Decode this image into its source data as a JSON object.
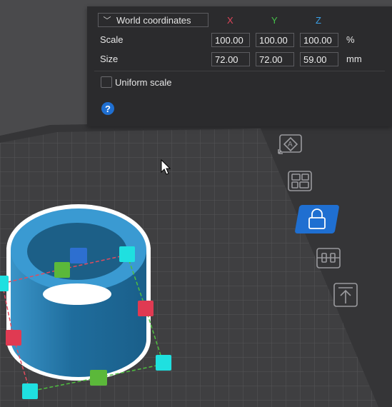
{
  "panel": {
    "coordinate_system": "World coordinates",
    "axes": {
      "x": "X",
      "y": "Y",
      "z": "Z"
    },
    "scale": {
      "label": "Scale",
      "x": "100.00",
      "y": "100.00",
      "z": "100.00",
      "unit": "%"
    },
    "size": {
      "label": "Size",
      "x": "72.00",
      "y": "72.00",
      "z": "59.00",
      "unit": "mm"
    },
    "uniform_scale": {
      "label": "Uniform scale",
      "checked": false
    },
    "help_icon": "question-circle-icon"
  },
  "toolbar": {
    "items": [
      {
        "name": "auto-orient-icon",
        "active": false
      },
      {
        "name": "arrange-icon",
        "active": false
      },
      {
        "name": "lock-icon",
        "active": true
      },
      {
        "name": "layer-editor-icon",
        "active": false
      },
      {
        "name": "lay-on-face-icon",
        "active": false
      }
    ]
  },
  "colors": {
    "panel_bg": "#2b2b2d",
    "axis_x": "#e0455a",
    "axis_y": "#46c24a",
    "axis_z": "#3ba1e8",
    "accent": "#1f6fd1",
    "model": "#2a7fb2"
  }
}
